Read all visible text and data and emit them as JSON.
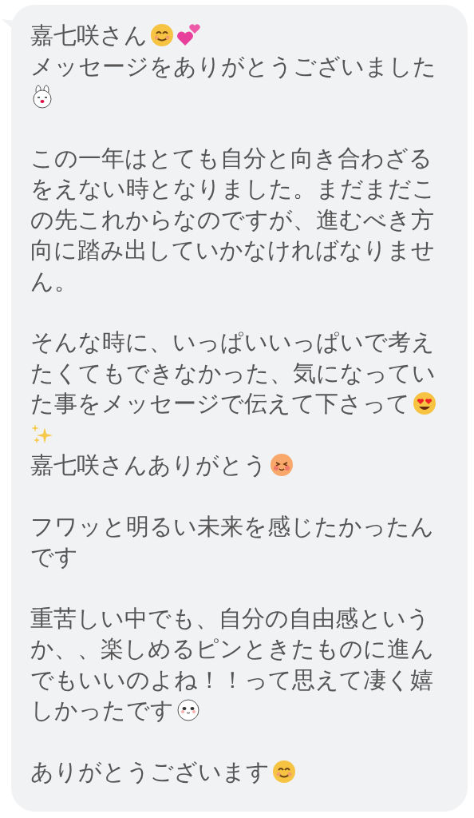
{
  "message": {
    "paragraphs": [
      {
        "lines": [
          {
            "text": "嘉七咲さん",
            "emojis": [
              {
                "kind": "smile"
              },
              {
                "kind": "hearts"
              }
            ]
          },
          {
            "text": "メッセージをありがとうございました"
          },
          {
            "emojis": [
              {
                "kind": "rabbit"
              }
            ]
          }
        ]
      },
      {
        "lines": [
          {
            "text": "この一年はとても自分と向き合わざる"
          },
          {
            "text": "をえない時となりました。まだまだこ"
          },
          {
            "text": "の先これからなのですが、進むべき方"
          },
          {
            "text": "向に踏み出していかなければなりませ"
          },
          {
            "text": "ん。"
          }
        ]
      },
      {
        "lines": [
          {
            "text": "そんな時に、いっぱいいっぱいで考え"
          },
          {
            "text": "たくてもできなかった、気になってい"
          },
          {
            "text": "た事をメッセージで伝えて下さって",
            "emojis": [
              {
                "kind": "heart-eyes"
              }
            ]
          },
          {
            "emojis": [
              {
                "kind": "sparkles"
              }
            ]
          },
          {
            "text": "嘉七咲さんありがとう",
            "emojis": [
              {
                "kind": "blush"
              }
            ]
          }
        ]
      },
      {
        "lines": [
          {
            "text": "フワッと明るい未来を感じたかったん"
          },
          {
            "text": "です"
          }
        ]
      },
      {
        "lines": [
          {
            "text": "重苦しい中でも、自分の自由感という"
          },
          {
            "text": "か、、楽しめるピンときたものに進ん"
          },
          {
            "text": "でもいいのよね！！って思えて凄く嬉"
          },
          {
            "text": "しかったです",
            "emojis": [
              {
                "kind": "panda"
              }
            ]
          }
        ]
      },
      {
        "lines": [
          {
            "text": "ありがとうございます",
            "emojis": [
              {
                "kind": "smile"
              }
            ]
          }
        ]
      }
    ]
  }
}
